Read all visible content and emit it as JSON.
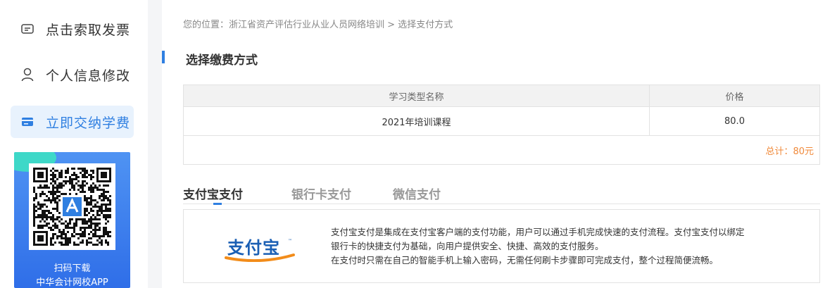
{
  "sidebar": {
    "items": [
      {
        "label": "点击索取发票",
        "icon": "invoice-icon",
        "active": false
      },
      {
        "label": "个人信息修改",
        "icon": "user-icon",
        "active": false
      },
      {
        "label": "立即交纳学费",
        "icon": "card-icon",
        "active": true
      }
    ],
    "qr": {
      "caption_line1": "扫码下载",
      "caption_line2": "中华会计网校APP"
    }
  },
  "breadcrumb": {
    "prefix": "您的位置：",
    "path": "浙江省资产评估行业从业人员网络培训",
    "separator": ">",
    "current": "选择支付方式"
  },
  "section": {
    "title": "选择缴费方式"
  },
  "fee_table": {
    "headers": [
      "学习类型名称",
      "价格"
    ],
    "rows": [
      {
        "name": "2021年培训课程",
        "price": "80.0"
      }
    ],
    "total": "总计：80元"
  },
  "payment": {
    "tabs": [
      {
        "label": "支付宝支付",
        "active": true
      },
      {
        "label": "银行卡支付",
        "active": false
      },
      {
        "label": "微信支付",
        "active": false
      }
    ],
    "logo_text": "支付宝",
    "description": [
      "支付宝支付是集成在支付宝客户端的支付功能，用户可以通过手机完成快速的支付流程。支付宝支付以绑定",
      "银行卡的快捷支付为基础，向用户提供安全、快捷、高效的支付服务。",
      "在支付时只需在自己的智能手机上输入密码，无需任何刷卡步骤即可完成支付，整个过程简便流畅。"
    ]
  },
  "colors": {
    "accent": "#2f7fe1",
    "active_bg": "#e8f2fd",
    "total": "#f08a3b",
    "alipay_blue": "#1a5fb4",
    "alipay_orange": "#f28c1a"
  }
}
